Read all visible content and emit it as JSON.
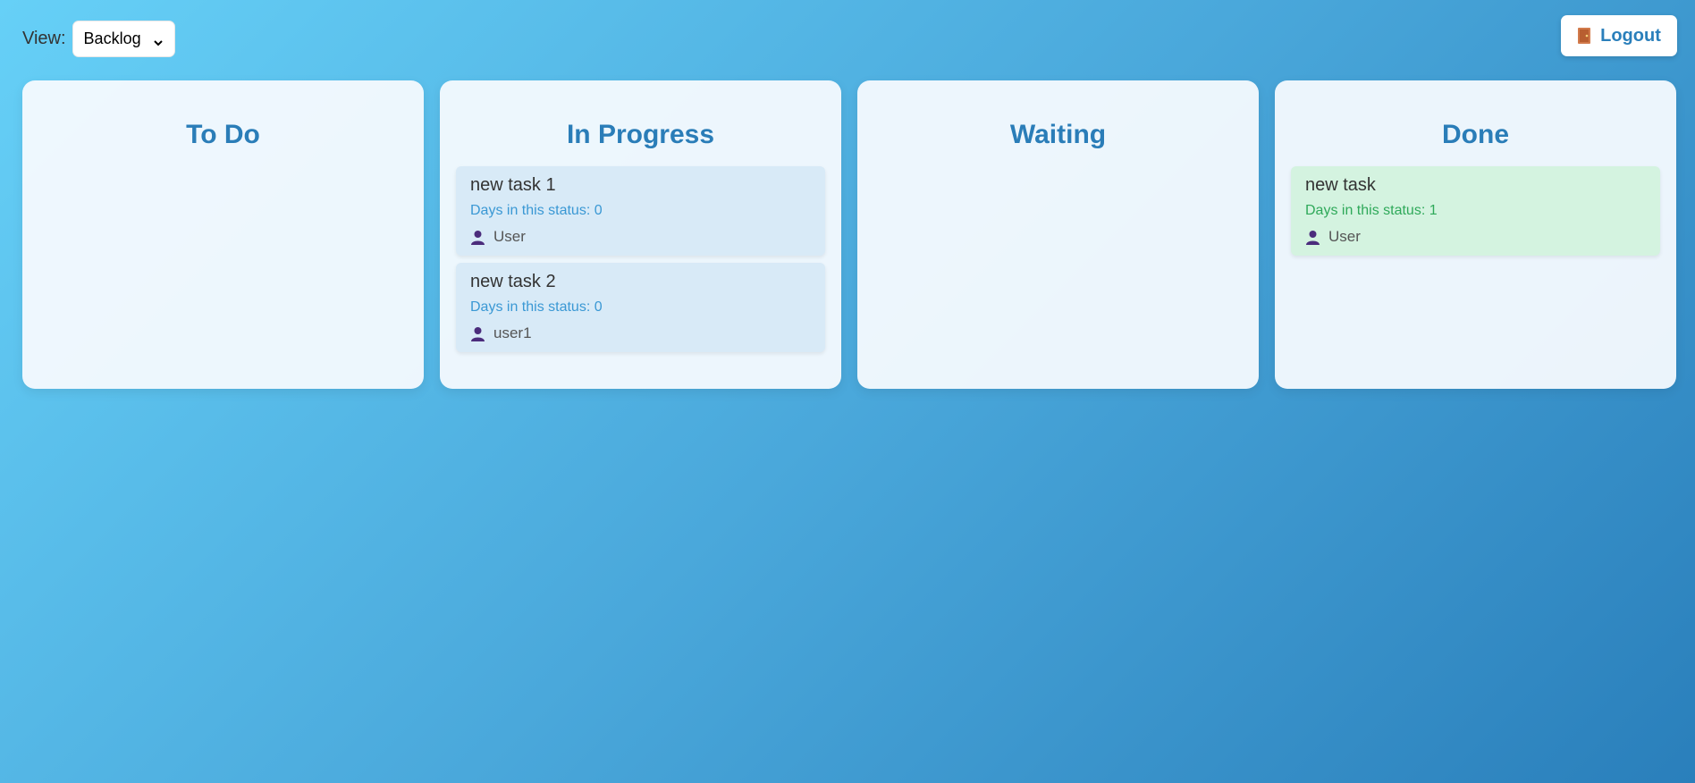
{
  "header": {
    "view_label": "View:",
    "view_selected": "Backlog",
    "logout_label": "Logout"
  },
  "columns": [
    {
      "title": "To Do",
      "tasks": []
    },
    {
      "title": "In Progress",
      "tasks": [
        {
          "title": "new task 1",
          "days": "Days in this status: 0",
          "user": "User"
        },
        {
          "title": "new task 2",
          "days": "Days in this status: 0",
          "user": "user1"
        }
      ]
    },
    {
      "title": "Waiting",
      "tasks": []
    },
    {
      "title": "Done",
      "tasks": [
        {
          "title": "new task",
          "days": "Days in this status: 1",
          "user": "User"
        }
      ]
    }
  ],
  "icons": {
    "logout": "door-icon",
    "user": "user-icon",
    "select": "chevron-down-icon"
  },
  "colors": {
    "accent": "#2a7fbb",
    "progress_card": "#d8eaf7",
    "done_card": "#d4f3e0",
    "user_icon": "#4b2c7c",
    "door_icon": "#d27a4b"
  }
}
